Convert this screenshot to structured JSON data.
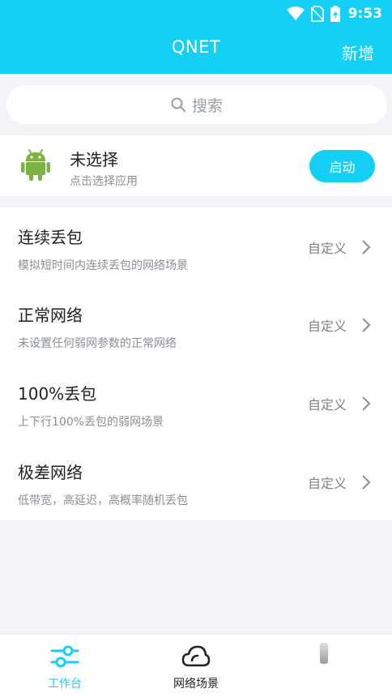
{
  "status": {
    "time": "9:53"
  },
  "header": {
    "title": "QNET",
    "add_label": "新增"
  },
  "search": {
    "placeholder": "搜索"
  },
  "app": {
    "title": "未选择",
    "subtitle": "点击选择应用",
    "start_label": "启动"
  },
  "scenes": [
    {
      "title": "连续丢包",
      "desc": "模拟短时间内连续丢包的网络场景",
      "action": "自定义"
    },
    {
      "title": "正常网络",
      "desc": "未设置任何弱网参数的正常网络",
      "action": "自定义"
    },
    {
      "title": "100%丢包",
      "desc": "上下行100%丢包的弱网场景",
      "action": "自定义"
    },
    {
      "title": "极差网络",
      "desc": "低带宽，高延迟，高概率随机丢包",
      "action": "自定义"
    }
  ],
  "tabs": [
    {
      "label": "工作台",
      "icon": "sliders-icon",
      "active": true
    },
    {
      "label": "网络场景",
      "icon": "cloud-icon",
      "active": false
    }
  ],
  "colors": {
    "accent": "#15d0f5",
    "android": "#7cb342",
    "active_tab": "#15d0f5"
  }
}
